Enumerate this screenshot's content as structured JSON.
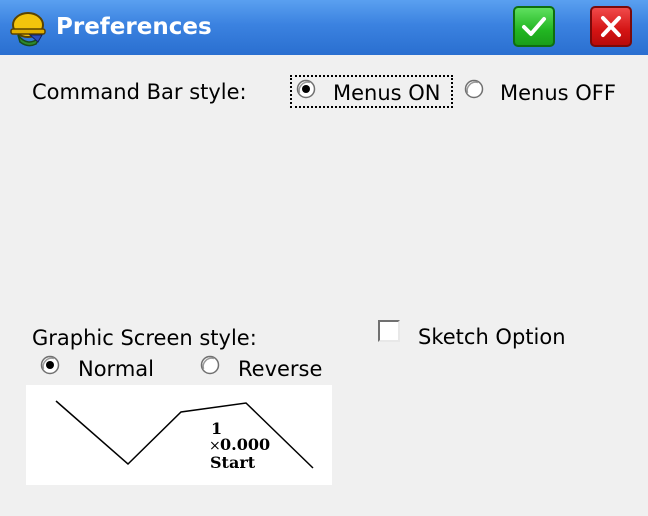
{
  "titlebar": {
    "title": "Preferences",
    "app_icon": "surveyor-helmet-icon",
    "ok_icon": "checkmark-icon",
    "close_icon": "close-x-icon"
  },
  "command_bar": {
    "label": "Command Bar style:",
    "options": [
      {
        "label": "Menus ON",
        "selected": true
      },
      {
        "label": "Menus OFF",
        "selected": false
      }
    ]
  },
  "graphic_screen": {
    "label": "Graphic Screen style:",
    "options": [
      {
        "label": "Normal",
        "selected": true
      },
      {
        "label": "Reverse",
        "selected": false
      }
    ]
  },
  "sketch_option": {
    "label": "Sketch Option",
    "checked": false
  },
  "preview": {
    "point_number": "1",
    "marker": "×",
    "elevation": "0.000",
    "caption": "Start"
  },
  "colors": {
    "titlebar": "#3b82e0",
    "ok_button": "#22b622",
    "close_button": "#d41414",
    "background": "#f0f0f0"
  }
}
